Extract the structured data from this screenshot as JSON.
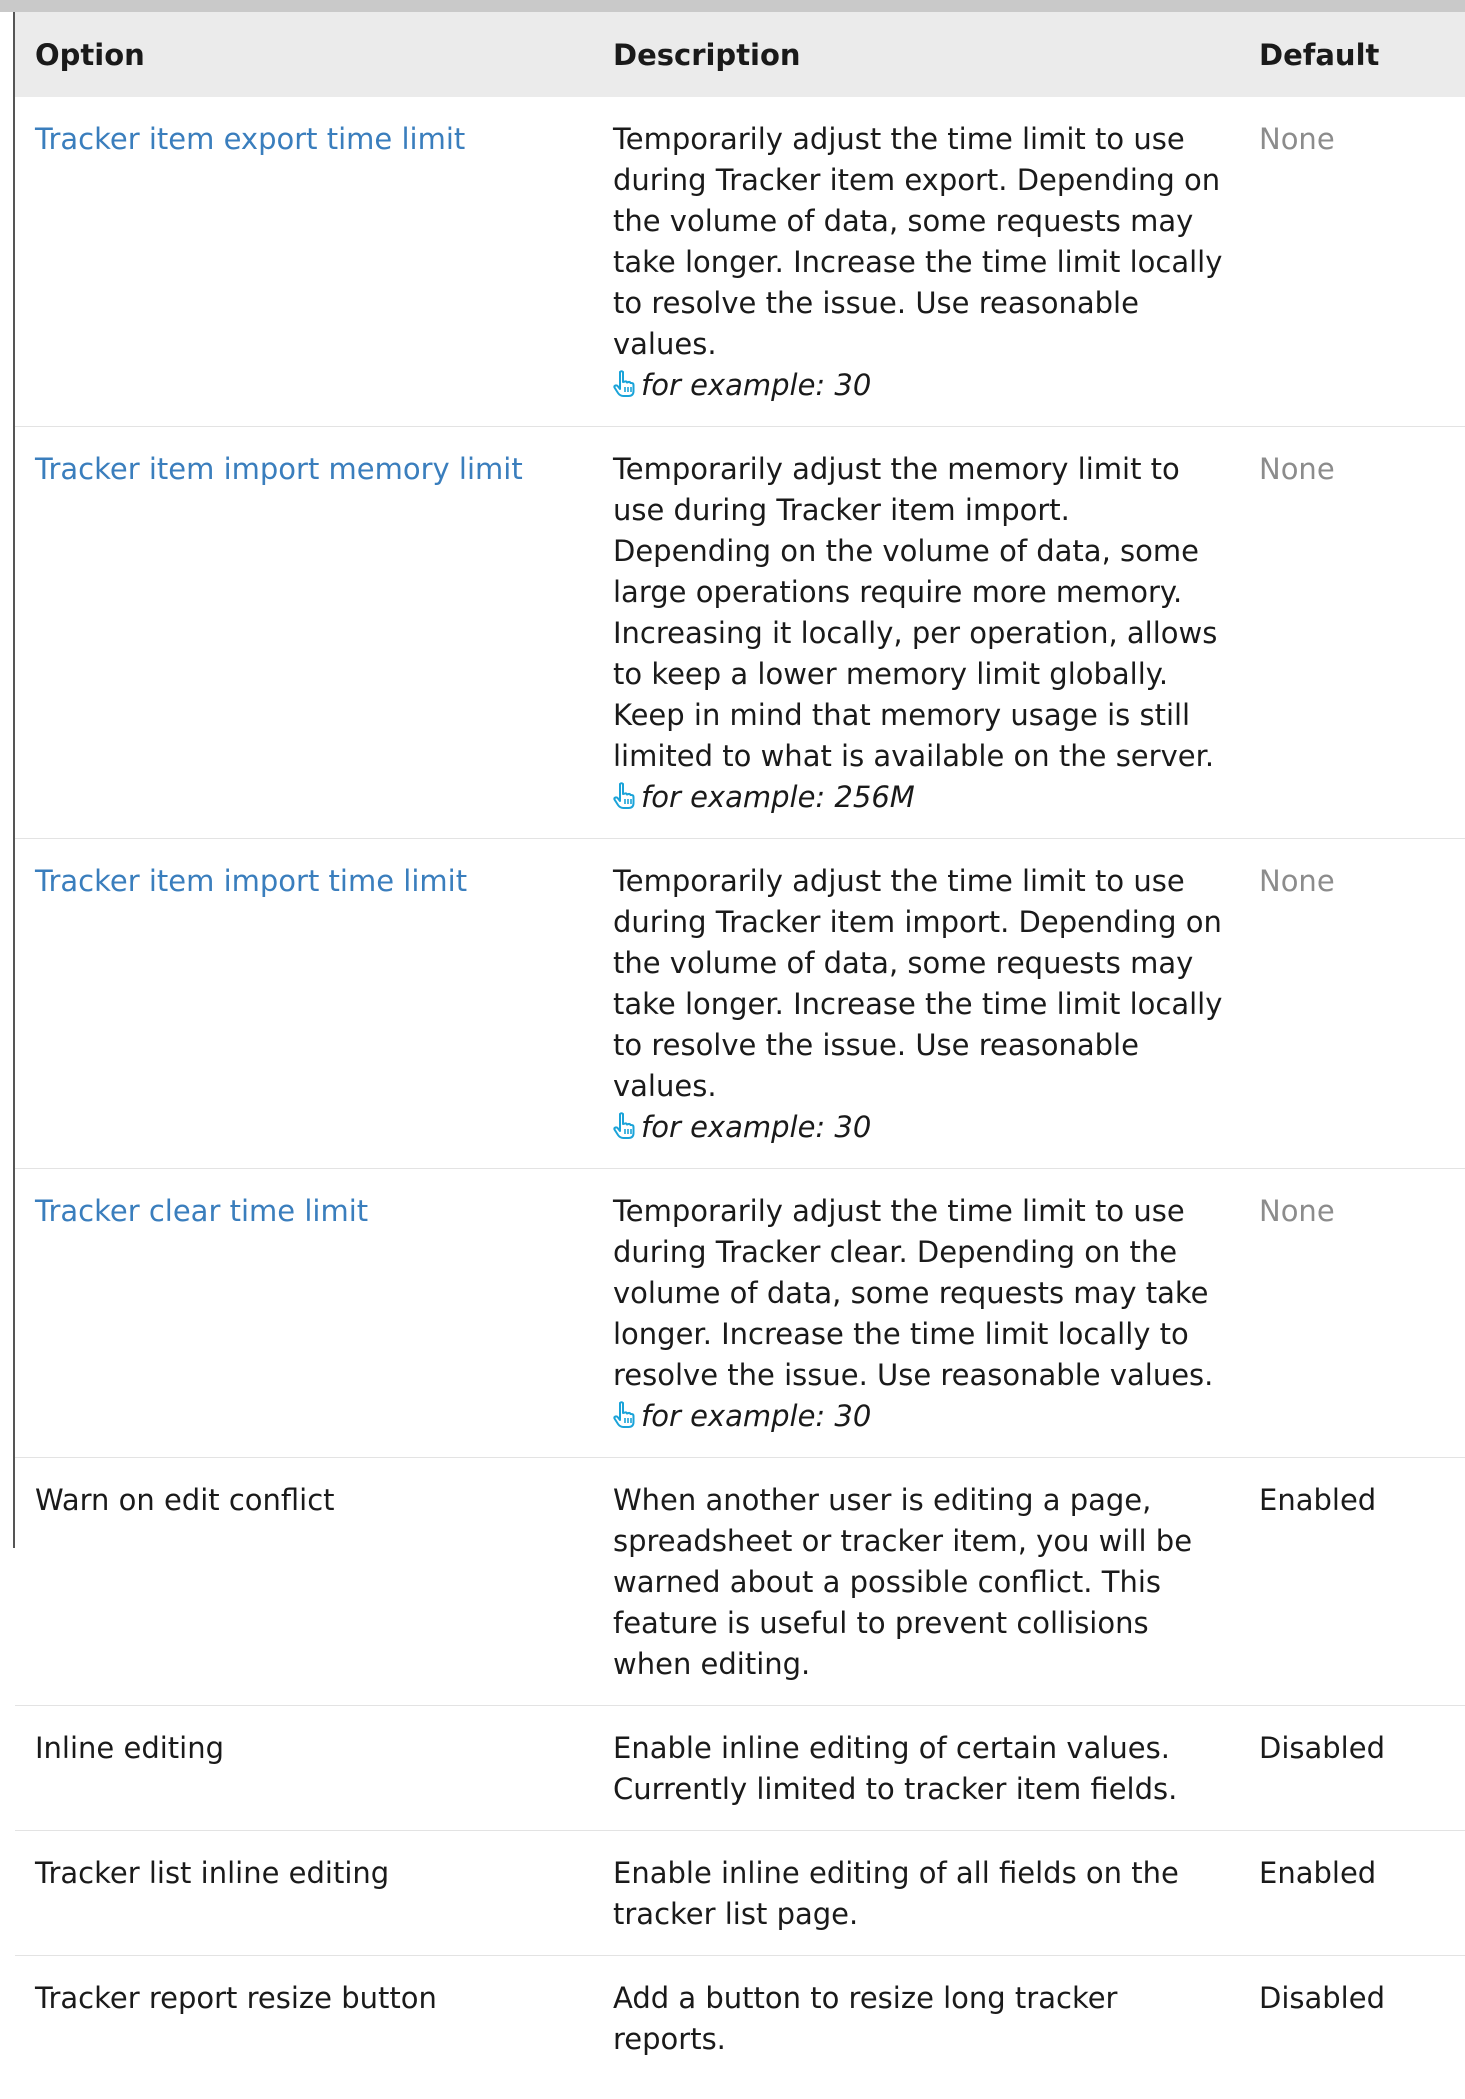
{
  "table": {
    "headers": {
      "option": "Option",
      "description": "Description",
      "default": "Default"
    },
    "rows": [
      {
        "option": "Tracker item export time limit",
        "option_is_link": true,
        "description": "Temporarily adjust the time limit to use during Tracker item export. Depending on the volume of data, some requests may take longer. Increase the time limit locally to resolve the issue. Use reasonable values.",
        "example": "for example: 30",
        "default": "None"
      },
      {
        "option": "Tracker item import memory limit",
        "option_is_link": true,
        "description": "Temporarily adjust the memory limit to use during Tracker item import. Depending on the volume of data, some large operations require more memory. Increasing it locally, per operation, allows to keep a lower memory limit globally. Keep in mind that memory usage is still limited to what is available on the server.",
        "example": "for example: 256M",
        "default": "None"
      },
      {
        "option": "Tracker item import time limit",
        "option_is_link": true,
        "description": "Temporarily adjust the time limit to use during Tracker item import. Depending on the volume of data, some requests may take longer. Increase the time limit locally to resolve the issue. Use reasonable values.",
        "example": "for example: 30",
        "default": "None"
      },
      {
        "option": "Tracker clear time limit",
        "option_is_link": true,
        "description": "Temporarily adjust the time limit to use during Tracker clear. Depending on the volume of data, some requests may take longer. Increase the time limit locally to resolve the issue. Use reasonable values.",
        "example": "for example: 30",
        "default": "None"
      },
      {
        "option": "Warn on edit conflict",
        "option_is_link": false,
        "description": "When another user is editing a page, spreadsheet or tracker item, you will be warned about a possible conflict. This feature is useful to prevent collisions when editing.",
        "default": "Enabled"
      },
      {
        "option": "Inline editing",
        "option_is_link": false,
        "description": "Enable inline editing of certain values. Currently limited to tracker item fields.",
        "default": "Disabled"
      },
      {
        "option": "Tracker list inline editing",
        "option_is_link": false,
        "description": "Enable inline editing of all fields on the tracker list page.",
        "default": "Enabled"
      },
      {
        "option": "Tracker report resize button",
        "option_is_link": false,
        "description": "Add a button to resize long tracker reports.",
        "default": "Disabled"
      }
    ]
  },
  "icons": {
    "example_icon": "pointing-hand-icon"
  },
  "colors": {
    "link": "#3a7ebd",
    "muted_default": "#8c8c8c",
    "header_bg": "#ebebeb",
    "icon": "#1aa3d9"
  }
}
